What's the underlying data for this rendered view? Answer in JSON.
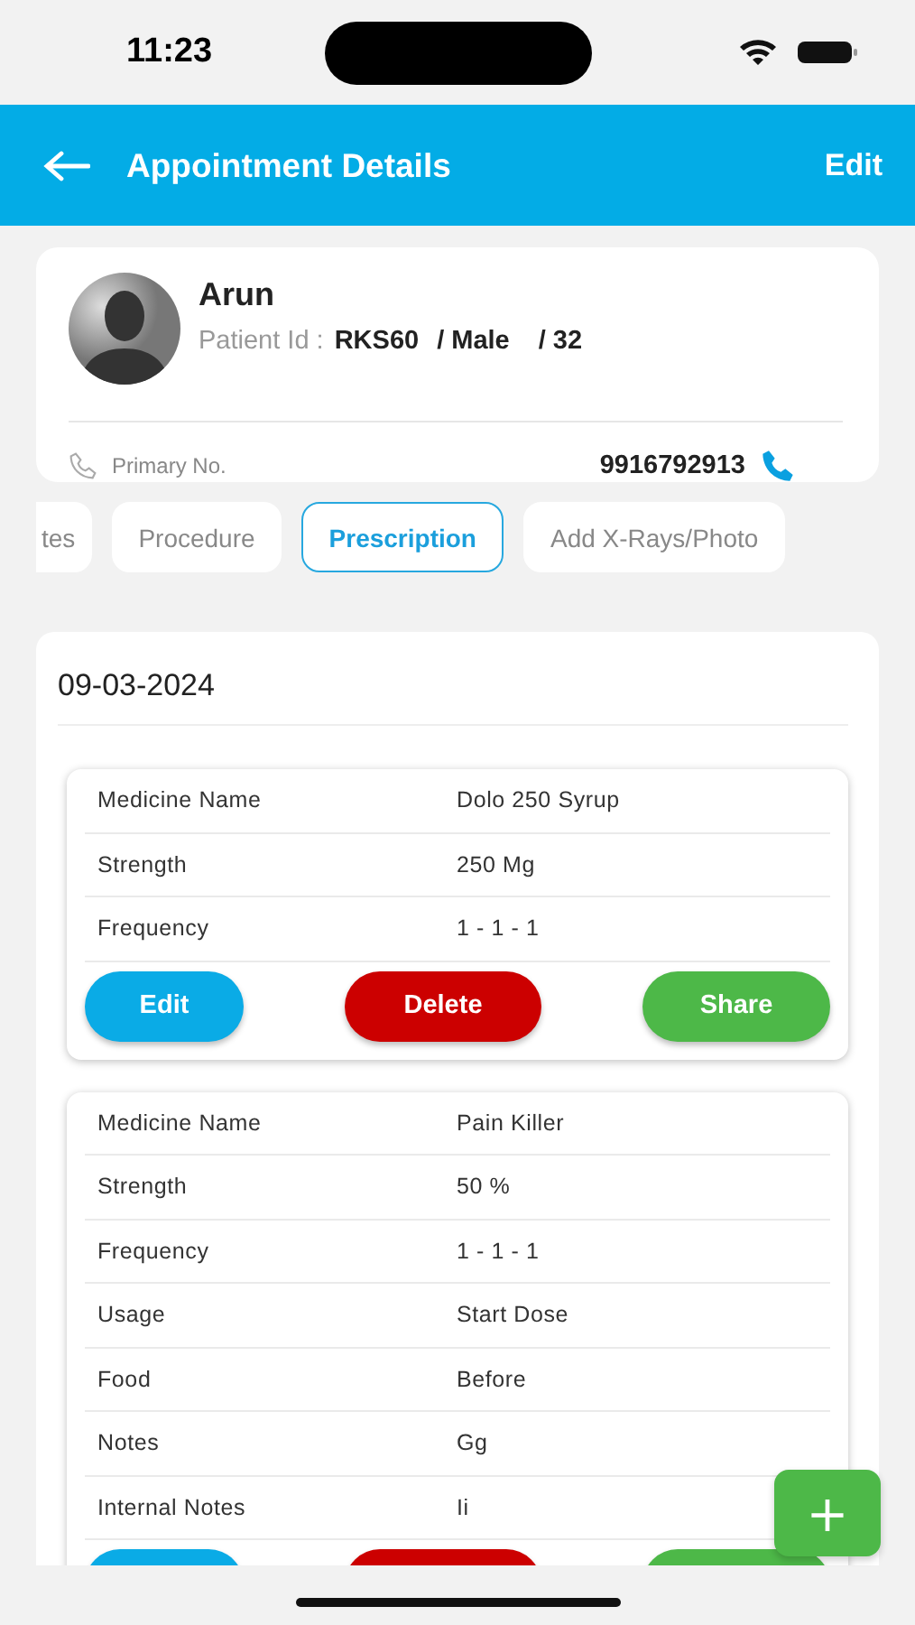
{
  "status_bar": {
    "time": "11:23"
  },
  "header": {
    "title": "Appointment Details",
    "action": "Edit"
  },
  "patient": {
    "name": "Arun",
    "id_label": "Patient Id :",
    "id": "RKS60",
    "gender": "/ Male",
    "age": "/ 32",
    "phone_label": "Primary No.",
    "phone": "9916792913"
  },
  "tabs": [
    {
      "label": "tes",
      "selected": false
    },
    {
      "label": "Procedure",
      "selected": false
    },
    {
      "label": "Prescription",
      "selected": true
    },
    {
      "label": "Add X-Rays/Photo",
      "selected": false
    }
  ],
  "prescriptions": {
    "date": "09-03-2024",
    "cards": [
      {
        "rows": [
          {
            "label": "Medicine Name",
            "value": "Dolo 250 Syrup"
          },
          {
            "label": "Strength",
            "value": "250 Mg"
          },
          {
            "label": "Frequency",
            "value": "1 - 1 - 1"
          }
        ],
        "actions": [
          {
            "kind": "edit",
            "label": "Edit"
          },
          {
            "kind": "delete",
            "label": "Delete"
          },
          {
            "kind": "share",
            "label": "Share"
          }
        ]
      },
      {
        "rows": [
          {
            "label": "Medicine Name",
            "value": "Pain Killer"
          },
          {
            "label": "Strength",
            "value": "50 %"
          },
          {
            "label": "Frequency",
            "value": "1 - 1 - 1"
          },
          {
            "label": "Usage",
            "value": "Start Dose"
          },
          {
            "label": "Food",
            "value": "Before"
          },
          {
            "label": "Notes",
            "value": "Gg"
          },
          {
            "label": "Internal Notes",
            "value": "Ii"
          }
        ],
        "actions": [
          {
            "kind": "edit"
          },
          {
            "kind": "delete"
          },
          {
            "kind": "share"
          }
        ]
      }
    ]
  },
  "fab": {
    "label": "+"
  }
}
